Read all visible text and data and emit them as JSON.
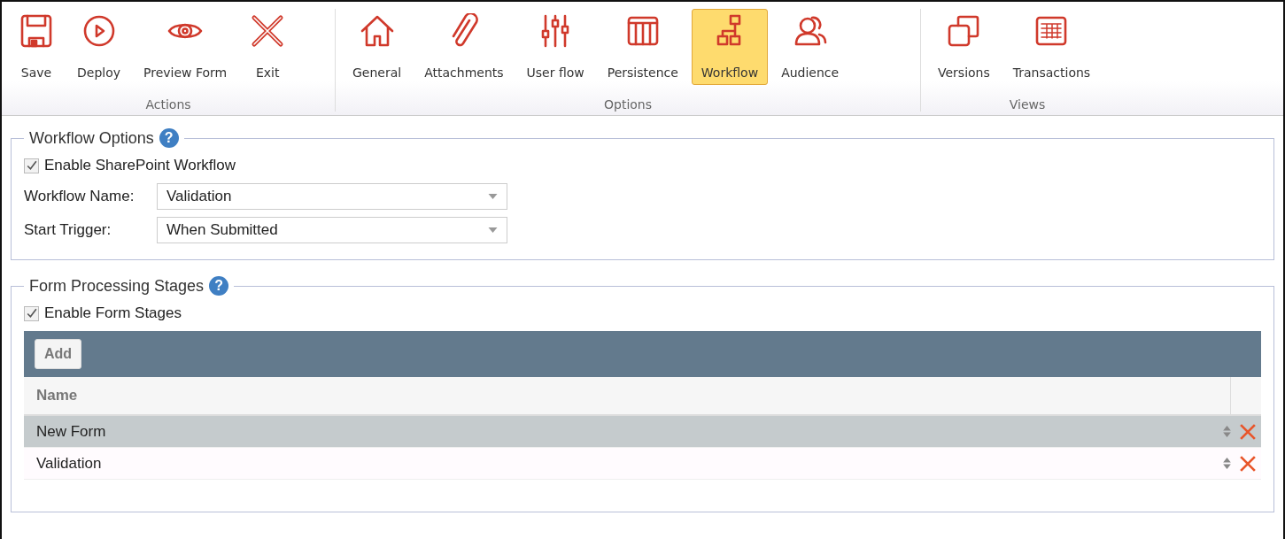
{
  "ribbon": {
    "groups": [
      {
        "label": "Actions",
        "items": [
          {
            "label": "Save",
            "kind": "save",
            "selected": false
          },
          {
            "label": "Deploy",
            "kind": "play",
            "selected": false
          },
          {
            "label": "Preview Form",
            "kind": "eye",
            "selected": false
          },
          {
            "label": "Exit",
            "kind": "cross",
            "selected": false
          }
        ]
      },
      {
        "label": "Options",
        "items": [
          {
            "label": "General",
            "kind": "home",
            "selected": false
          },
          {
            "label": "Attachments",
            "kind": "clip",
            "selected": false
          },
          {
            "label": "User flow",
            "kind": "sliders",
            "selected": false
          },
          {
            "label": "Persistence",
            "kind": "columns",
            "selected": false
          },
          {
            "label": "Workflow",
            "kind": "flow",
            "selected": true
          },
          {
            "label": "Audience",
            "kind": "people",
            "selected": false
          }
        ]
      },
      {
        "label": "Views",
        "items": [
          {
            "label": "Versions",
            "kind": "copy",
            "selected": false
          },
          {
            "label": "Transactions",
            "kind": "sheet",
            "selected": false
          }
        ]
      }
    ]
  },
  "workflow_options": {
    "title": "Workflow Options",
    "help": "?",
    "enable": {
      "label": "Enable SharePoint Workflow",
      "checked": true
    },
    "fields": [
      {
        "label": "Workflow Name:",
        "value": "Validation"
      },
      {
        "label": "Start Trigger:",
        "value": "When Submitted"
      }
    ]
  },
  "form_stages": {
    "title": "Form Processing Stages",
    "help": "?",
    "enable": {
      "label": "Enable Form Stages",
      "checked": true
    },
    "add_button": "Add",
    "column": "Name",
    "rows": [
      {
        "name": "New Form",
        "selected": true
      },
      {
        "name": "Validation",
        "selected": false
      }
    ]
  }
}
